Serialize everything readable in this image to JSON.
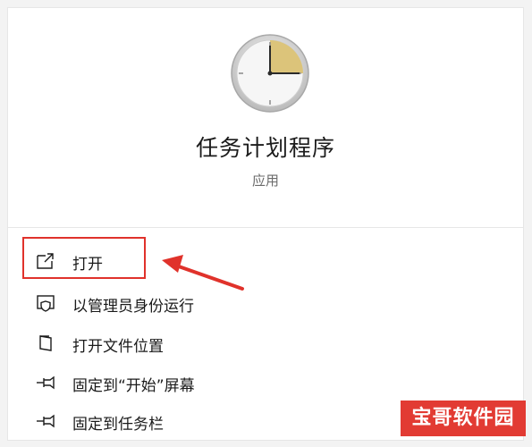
{
  "app": {
    "icon": "clock-icon",
    "title": "任务计划程序",
    "type": "应用"
  },
  "menu": {
    "items": [
      {
        "label": "打开",
        "icon": "open-icon",
        "highlighted": true
      },
      {
        "label": "以管理员身份运行",
        "icon": "shield-icon",
        "highlighted": false
      },
      {
        "label": "打开文件位置",
        "icon": "folder-icon",
        "highlighted": false
      },
      {
        "label": "固定到“开始”屏幕",
        "icon": "pin-icon",
        "highlighted": false
      },
      {
        "label": "固定到任务栏",
        "icon": "pin-icon",
        "highlighted": false
      }
    ]
  },
  "annotation": {
    "highlight_color": "#e0322b"
  },
  "watermark": {
    "text": "宝哥软件园",
    "color": "#e23b33"
  },
  "colors": {
    "clock_face": "#f5f5f5",
    "clock_slice": "#dcc47a",
    "text": "#1b1b1b",
    "subtext": "#6b6b6b"
  }
}
